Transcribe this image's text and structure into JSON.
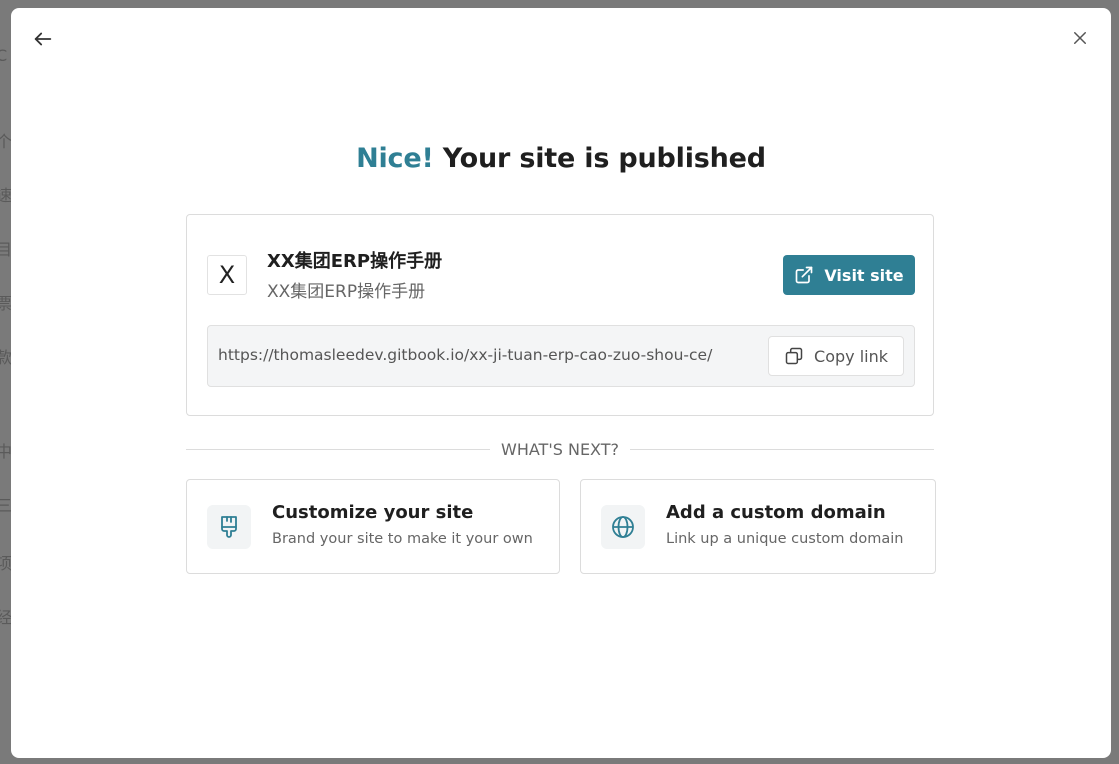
{
  "background_fragments": [
    "C",
    "个",
    "速",
    "目",
    "票",
    "款",
    "中",
    "三",
    "项",
    "经"
  ],
  "modal": {
    "back_icon": "arrow-left-icon",
    "close_icon": "close-icon",
    "title_accent": "Nice!",
    "title_rest": " Your site is published",
    "site": {
      "logo_letter": "X",
      "name": "XX集团ERP操作手册",
      "subtitle": "XX集团ERP操作手册",
      "visit_label": "Visit site",
      "visit_icon": "external-link-icon",
      "url": "https://thomasleedev.gitbook.io/xx-ji-tuan-erp-cao-zuo-shou-ce/",
      "copy_label": "Copy link",
      "copy_icon": "copy-icon"
    },
    "whats_next": "WHAT'S NEXT?",
    "actions": [
      {
        "title": "Customize your site",
        "description": "Brand your site to make it your own",
        "icon": "paintbrush-icon"
      },
      {
        "title": "Add a custom domain",
        "description": "Link up a unique custom domain",
        "icon": "globe-icon"
      }
    ]
  },
  "colors": {
    "accent": "#2f7f94",
    "overlay": "#7a7a7a",
    "text": "#1f1f1f",
    "muted": "#666666"
  }
}
